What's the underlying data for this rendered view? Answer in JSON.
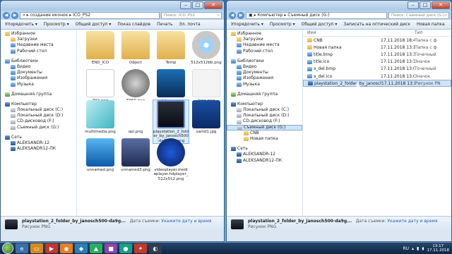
{
  "left_window": {
    "address": [
      "«",
      "создание иконок",
      "ICO_PS2"
    ],
    "search_placeholder": "Поиск: ICO_PS2",
    "toolbar": [
      "Упорядочить ▾",
      "Просмотр ▾",
      "Общий доступ ▾",
      "Показ слайдов",
      "Печать",
      "Эл. почта"
    ],
    "nav": [
      {
        "label": "Избранное",
        "icon": "star-icon"
      },
      {
        "label": "Загрузки",
        "icon": "folder-icon"
      },
      {
        "label": "Недавние места",
        "icon": "recent-icon"
      },
      {
        "label": "Рабочий стол",
        "icon": "desktop-icon"
      },
      {
        "label": "",
        "icon": ""
      },
      {
        "label": "Библиотеки",
        "icon": "library-icon"
      },
      {
        "label": "Видео",
        "icon": "video-icon"
      },
      {
        "label": "Документы",
        "icon": "documents-icon"
      },
      {
        "label": "Изображения",
        "icon": "pictures-icon"
      },
      {
        "label": "Музыка",
        "icon": "music-icon"
      },
      {
        "label": "",
        "icon": ""
      },
      {
        "label": "Домашняя группа",
        "icon": "homegroup-icon"
      },
      {
        "label": "",
        "icon": ""
      },
      {
        "label": "Компьютер",
        "icon": "computer-icon"
      },
      {
        "label": "Локальный диск (C:)",
        "icon": "drive-icon"
      },
      {
        "label": "Локальный диск (D:)",
        "icon": "drive-icon"
      },
      {
        "label": "CD-дисковод (F:)",
        "icon": "cd-icon"
      },
      {
        "label": "Съемный диск (G:)",
        "icon": "usb-drive-icon"
      },
      {
        "label": "",
        "icon": ""
      },
      {
        "label": "Сеть",
        "icon": "network-icon"
      },
      {
        "label": "ALEKSANDR-12",
        "icon": "pc-icon"
      },
      {
        "label": "ALEKSANDR12-ПК",
        "icon": "pc-icon"
      }
    ],
    "files": [
      {
        "name": "END_ICO",
        "kind": "folder"
      },
      {
        "name": "Object",
        "kind": "folder"
      },
      {
        "name": "Temp",
        "kind": "folder"
      },
      {
        "name": "512x512bb.png",
        "kind": "disc"
      },
      {
        "name": "792.png",
        "kind": "opl"
      },
      {
        "name": "6960.png",
        "kind": "q"
      },
      {
        "name": "blue.png",
        "kind": "film"
      },
      {
        "name": "logo.png",
        "kind": "blank"
      },
      {
        "name": "multimedia.png",
        "kind": "cubes"
      },
      {
        "name": "opl.png",
        "kind": "opltext"
      },
      {
        "name": "playstation_2_folder_by_janosch500-da9gx61.png",
        "kind": "ps2folder"
      },
      {
        "name": "samd1.jpg",
        "kind": "ps2"
      },
      {
        "name": "unnamed.png",
        "kind": "bluebox"
      },
      {
        "name": "unnamed3.png",
        "kind": "crate"
      },
      {
        "name": "videoplayer.mediaplayer.hdplayer_512x512.png",
        "kind": "play"
      }
    ],
    "details": {
      "name": "playstation_2_folder_by_janosch500-da9g...",
      "date_label": "Дата съемки:",
      "date_value": "Укажите дату и время",
      "type": "Рисунок PNG"
    }
  },
  "right_window": {
    "address": [
      "Компьютер",
      "Съемный диск (G:)"
    ],
    "search_placeholder": "Поиск: Съемный диск (G:)",
    "toolbar": [
      "Упорядочить ▾",
      "Просмотр ▾",
      "Общий доступ ▾",
      "Записать на оптический диск",
      "Новая папка"
    ],
    "nav": [
      {
        "label": "Избранное",
        "icon": "star-icon"
      },
      {
        "label": "Загрузки",
        "icon": "folder-icon"
      },
      {
        "label": "Недавние места",
        "icon": "recent-icon"
      },
      {
        "label": "Рабочий стол",
        "icon": "desktop-icon"
      },
      {
        "label": "",
        "icon": ""
      },
      {
        "label": "Библиотеки",
        "icon": "library-icon"
      },
      {
        "label": "Видео",
        "icon": "video-icon"
      },
      {
        "label": "Документы",
        "icon": "documents-icon"
      },
      {
        "label": "Изображения",
        "icon": "pictures-icon"
      },
      {
        "label": "Музыка",
        "icon": "music-icon"
      },
      {
        "label": "",
        "icon": ""
      },
      {
        "label": "Домашняя группа",
        "icon": "homegroup-icon"
      },
      {
        "label": "",
        "icon": ""
      },
      {
        "label": "Компьютер",
        "icon": "computer-icon"
      },
      {
        "label": "Локальный диск (C:)",
        "icon": "drive-icon"
      },
      {
        "label": "Локальный диск (D:)",
        "icon": "drive-icon"
      },
      {
        "label": "CD-дисковод (F:)",
        "icon": "cd-icon"
      },
      {
        "label": "Съемный диск (G:)",
        "icon": "usb-drive-icon"
      },
      {
        "label": "CNB",
        "icon": "folder-icon"
      },
      {
        "label": "Новая папка",
        "icon": "folder-icon"
      },
      {
        "label": "",
        "icon": ""
      },
      {
        "label": "Сеть",
        "icon": "network-icon"
      },
      {
        "label": "ALEKSANDR-12",
        "icon": "pc-icon"
      },
      {
        "label": "ALEKSANDR12-ПК",
        "icon": "pc-icon"
      }
    ],
    "columns": [
      "Имя",
      "",
      "Тип"
    ],
    "rows": [
      {
        "name": "CNB",
        "date": "17.11.2018 18:42",
        "type": "Папка с ф",
        "icon": "folder-icon"
      },
      {
        "name": "Новая папка",
        "date": "17.11.2018 13:14",
        "type": "Папка с ф",
        "icon": "folder-icon"
      },
      {
        "name": "title.bmp",
        "date": "17.11.2018 13:11",
        "type": "Точечный",
        "icon": "bmp-icon"
      },
      {
        "name": "title.ico",
        "date": "17.11.2018 13:11",
        "type": "Значок",
        "icon": "ico-icon"
      },
      {
        "name": "x_del.bmp",
        "date": "17.11.2018 13:06",
        "type": "Точечный",
        "icon": "bmp-icon"
      },
      {
        "name": "x_del.ico",
        "date": "17.11.2018 13:06",
        "type": "Значок",
        "icon": "ico-icon"
      },
      {
        "name": "playstation_2_folder_by_janosch500-da9...",
        "date": "17.11.2018 13:17",
        "type": "Рисунок PN",
        "icon": "png-icon"
      }
    ],
    "details": {
      "name": "playstation_2_folder_by_janosch500-da9g...",
      "date_label": "Дата съемки:",
      "date_value": "Укажите дату и время",
      "type": "Рисунок PNG"
    }
  },
  "taskbar": {
    "lang": "RU",
    "time": "13:17",
    "date": "17.11.2018"
  }
}
